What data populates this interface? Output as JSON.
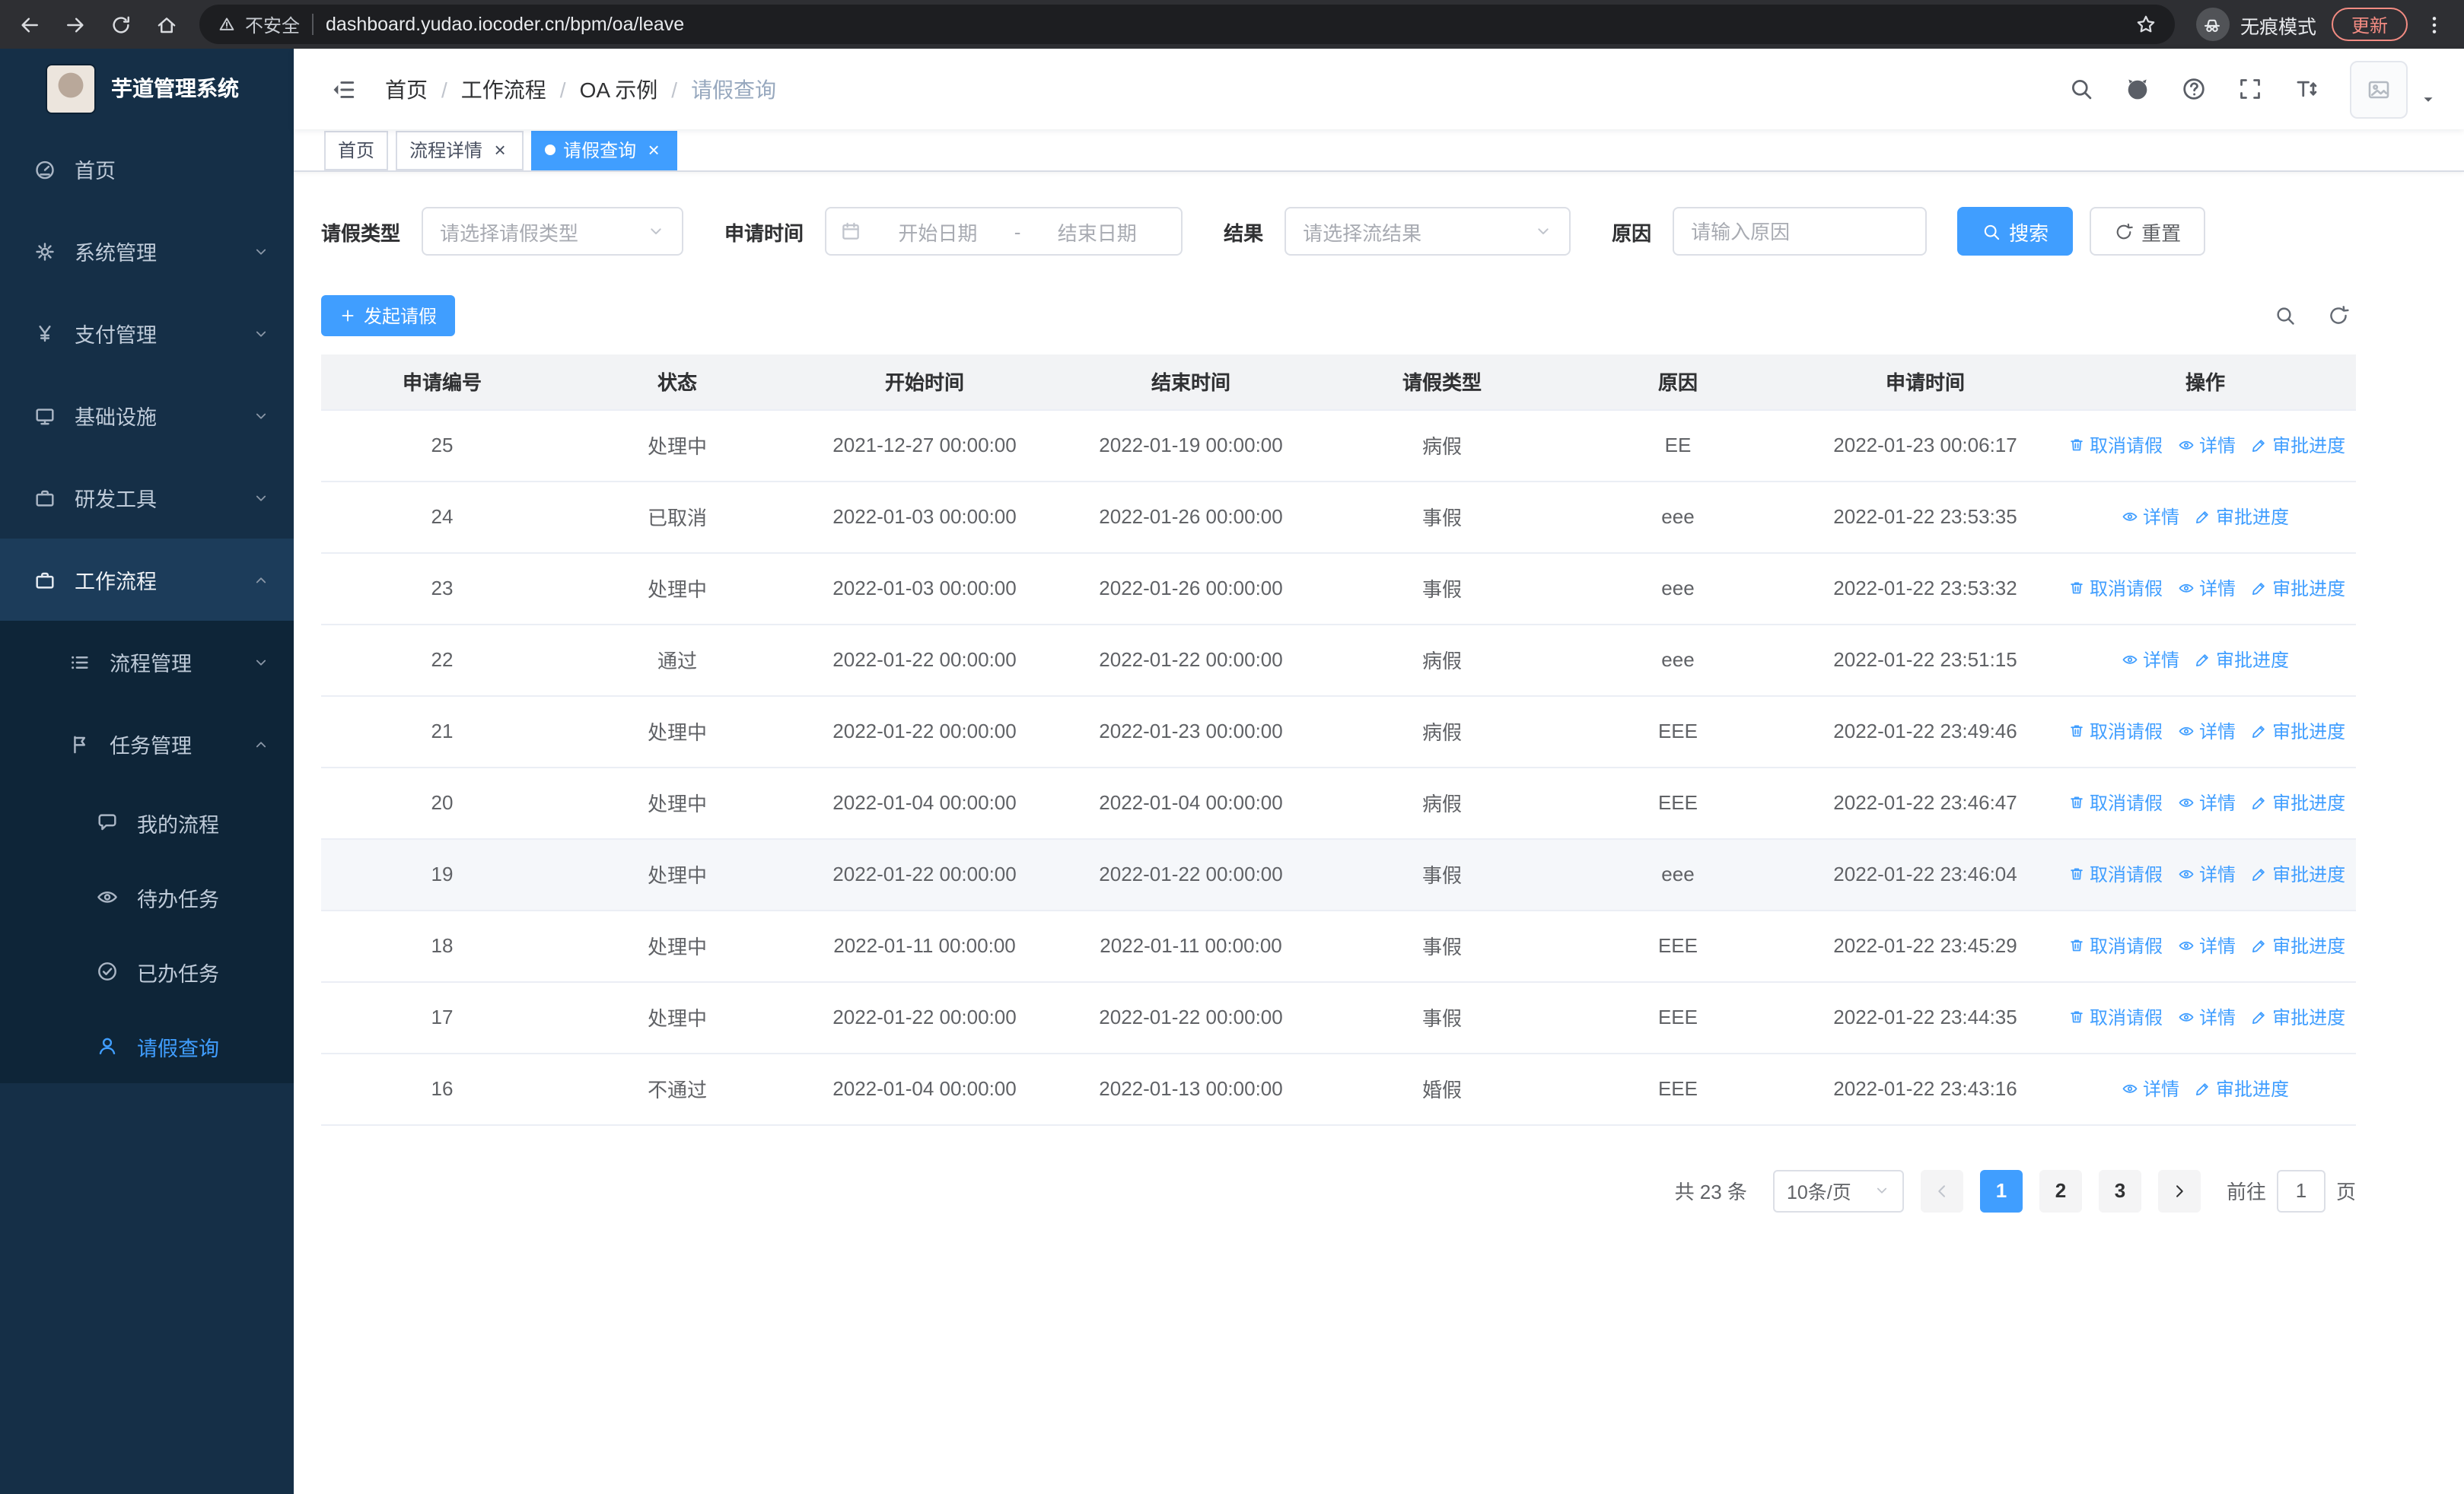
{
  "browser": {
    "nav_icons": [
      "back",
      "forward",
      "reload",
      "home"
    ],
    "security_label": "不安全",
    "url": "dashboard.yudao.iocoder.cn/bpm/oa/leave",
    "incognito_label": "无痕模式",
    "update_label": "更新"
  },
  "sidebar": {
    "app_title": "芋道管理系统",
    "items": [
      {
        "key": "home",
        "label": "首页",
        "icon": "dashboard-icon",
        "level": 1
      },
      {
        "key": "system",
        "label": "系统管理",
        "icon": "gear-icon",
        "level": 1,
        "arrow": "down"
      },
      {
        "key": "payment",
        "label": "支付管理",
        "icon": "yen-icon",
        "level": 1,
        "arrow": "down"
      },
      {
        "key": "infrastructure",
        "label": "基础设施",
        "icon": "monitor-icon",
        "level": 1,
        "arrow": "down"
      },
      {
        "key": "devtools",
        "label": "研发工具",
        "icon": "briefcase-icon",
        "level": 1,
        "arrow": "down"
      },
      {
        "key": "workflow",
        "label": "工作流程",
        "icon": "briefcase-icon",
        "level": 1,
        "arrow": "up",
        "highlight": true
      },
      {
        "key": "process-mgmt",
        "label": "流程管理",
        "icon": "list-icon",
        "level": 2,
        "arrow": "down"
      },
      {
        "key": "task-mgmt",
        "label": "任务管理",
        "icon": "flag-icon",
        "level": 2,
        "arrow": "up"
      },
      {
        "key": "my-process",
        "label": "我的流程",
        "icon": "chat-icon",
        "level": 3
      },
      {
        "key": "todo-tasks",
        "label": "待办任务",
        "icon": "eye-icon",
        "level": 3
      },
      {
        "key": "done-tasks",
        "label": "已办任务",
        "icon": "check-icon",
        "level": 3
      },
      {
        "key": "leave-query",
        "label": "请假查询",
        "icon": "user-icon",
        "level": 3,
        "active": true
      }
    ]
  },
  "header": {
    "breadcrumb": [
      "首页",
      "工作流程",
      "OA 示例",
      "请假查询"
    ],
    "action_icons": [
      "search",
      "github",
      "help",
      "fullscreen",
      "fontsize"
    ]
  },
  "tabs": [
    {
      "key": "home",
      "label": "首页",
      "closable": false,
      "active": false
    },
    {
      "key": "process-detail",
      "label": "流程详情",
      "closable": true,
      "active": false
    },
    {
      "key": "leave-query",
      "label": "请假查询",
      "closable": true,
      "active": true
    }
  ],
  "filters": {
    "leave_type": {
      "label": "请假类型",
      "placeholder": "请选择请假类型"
    },
    "apply_time": {
      "label": "申请时间",
      "start_placeholder": "开始日期",
      "separator": "-",
      "end_placeholder": "结束日期"
    },
    "result": {
      "label": "结果",
      "placeholder": "请选择流结果"
    },
    "reason": {
      "label": "原因",
      "placeholder": "请输入原因"
    },
    "search_label": "搜索",
    "reset_label": "重置"
  },
  "toolbar": {
    "create_label": "发起请假"
  },
  "table": {
    "columns": [
      "申请编号",
      "状态",
      "开始时间",
      "结束时间",
      "请假类型",
      "原因",
      "申请时间",
      "操作"
    ],
    "action_defs": {
      "cancel": {
        "label": "取消请假",
        "icon": "delete-icon"
      },
      "detail": {
        "label": "详情",
        "icon": "view-icon"
      },
      "progress": {
        "label": "审批进度",
        "icon": "edit-icon"
      }
    },
    "rows": [
      {
        "id": "25",
        "status": "处理中",
        "start": "2021-12-27 00:00:00",
        "end": "2022-01-19 00:00:00",
        "type": "病假",
        "reason": "EE",
        "apply_time": "2022-01-23 00:06:17",
        "actions": [
          "cancel",
          "detail",
          "progress"
        ]
      },
      {
        "id": "24",
        "status": "已取消",
        "start": "2022-01-03 00:00:00",
        "end": "2022-01-26 00:00:00",
        "type": "事假",
        "reason": "eee",
        "apply_time": "2022-01-22 23:53:35",
        "actions": [
          "detail",
          "progress"
        ]
      },
      {
        "id": "23",
        "status": "处理中",
        "start": "2022-01-03 00:00:00",
        "end": "2022-01-26 00:00:00",
        "type": "事假",
        "reason": "eee",
        "apply_time": "2022-01-22 23:53:32",
        "actions": [
          "cancel",
          "detail",
          "progress"
        ]
      },
      {
        "id": "22",
        "status": "通过",
        "start": "2022-01-22 00:00:00",
        "end": "2022-01-22 00:00:00",
        "type": "病假",
        "reason": "eee",
        "apply_time": "2022-01-22 23:51:15",
        "actions": [
          "detail",
          "progress"
        ]
      },
      {
        "id": "21",
        "status": "处理中",
        "start": "2022-01-22 00:00:00",
        "end": "2022-01-23 00:00:00",
        "type": "病假",
        "reason": "EEE",
        "apply_time": "2022-01-22 23:49:46",
        "actions": [
          "cancel",
          "detail",
          "progress"
        ]
      },
      {
        "id": "20",
        "status": "处理中",
        "start": "2022-01-04 00:00:00",
        "end": "2022-01-04 00:00:00",
        "type": "病假",
        "reason": "EEE",
        "apply_time": "2022-01-22 23:46:47",
        "actions": [
          "cancel",
          "detail",
          "progress"
        ]
      },
      {
        "id": "19",
        "status": "处理中",
        "start": "2022-01-22 00:00:00",
        "end": "2022-01-22 00:00:00",
        "type": "事假",
        "reason": "eee",
        "apply_time": "2022-01-22 23:46:04",
        "actions": [
          "cancel",
          "detail",
          "progress"
        ],
        "highlight": true
      },
      {
        "id": "18",
        "status": "处理中",
        "start": "2022-01-11 00:00:00",
        "end": "2022-01-11 00:00:00",
        "type": "事假",
        "reason": "EEE",
        "apply_time": "2022-01-22 23:45:29",
        "actions": [
          "cancel",
          "detail",
          "progress"
        ]
      },
      {
        "id": "17",
        "status": "处理中",
        "start": "2022-01-22 00:00:00",
        "end": "2022-01-22 00:00:00",
        "type": "事假",
        "reason": "EEE",
        "apply_time": "2022-01-22 23:44:35",
        "actions": [
          "cancel",
          "detail",
          "progress"
        ]
      },
      {
        "id": "16",
        "status": "不通过",
        "start": "2022-01-04 00:00:00",
        "end": "2022-01-13 00:00:00",
        "type": "婚假",
        "reason": "EEE",
        "apply_time": "2022-01-22 23:43:16",
        "actions": [
          "detail",
          "progress"
        ]
      }
    ]
  },
  "pagination": {
    "total_text": "共 23 条",
    "page_size_label": "10条/页",
    "pages": [
      "1",
      "2",
      "3"
    ],
    "active_page": "1",
    "goto_label": "前往",
    "goto_value": "1",
    "goto_suffix": "页"
  },
  "colors": {
    "primary": "#409eff",
    "sidebar_bg": "#152f47",
    "sidebar_sub_bg": "#0e2538"
  }
}
